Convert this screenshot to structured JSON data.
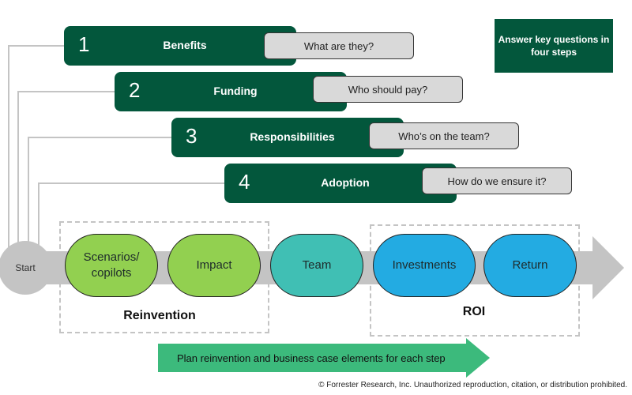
{
  "key_box": {
    "text": "Answer key questions in four steps",
    "color": "#03573c"
  },
  "steps": [
    {
      "number": "1",
      "label": "Benefits",
      "question": "What are they?"
    },
    {
      "number": "2",
      "label": "Funding",
      "question": "Who should pay?"
    },
    {
      "number": "3",
      "label": "Responsibilities",
      "question": "Who’s on the team?"
    },
    {
      "number": "4",
      "label": "Adoption",
      "question": "How do we ensure it?"
    }
  ],
  "flow": {
    "start_label": "Start",
    "nodes": [
      {
        "label": "Scenarios/ copilots",
        "color": "#92d050"
      },
      {
        "label": "Impact",
        "color": "#92d050"
      },
      {
        "label": "Team",
        "color": "#40bfb4"
      },
      {
        "label": "Investments",
        "color": "#23abe2"
      },
      {
        "label": "Return",
        "color": "#23abe2"
      }
    ],
    "groups": [
      {
        "label": "Reinvention"
      },
      {
        "label": "ROI"
      }
    ]
  },
  "plan_arrow": {
    "text": "Plan reinvention and business case elements for each step",
    "color": "#3cba7c"
  },
  "copyright": "© Forrester Research, Inc. Unauthorized reproduction, citation, or distribution prohibited."
}
